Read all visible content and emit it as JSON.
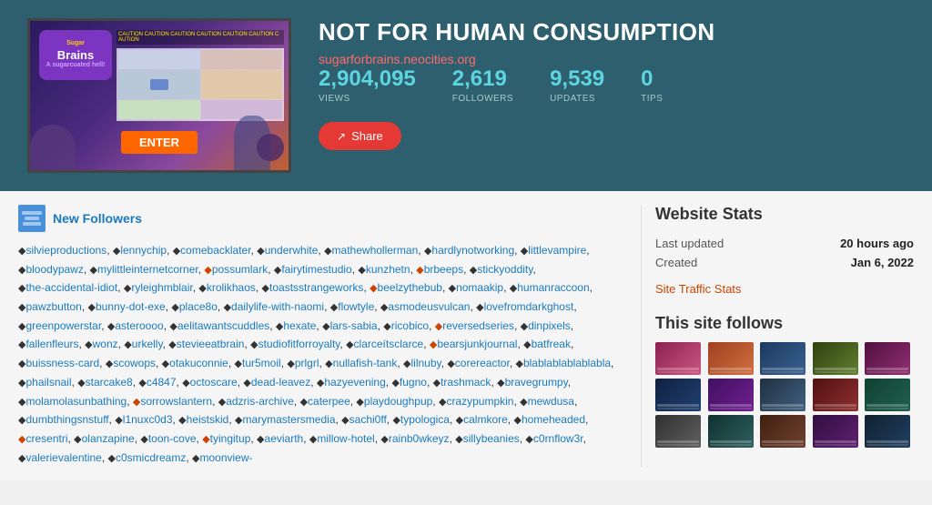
{
  "hero": {
    "title": "NOT FOR HUMAN CONSUMPTION",
    "url": "sugarforbrains.neocities.org",
    "stats": {
      "views": {
        "value": "2,904,095",
        "label": "VIEWS"
      },
      "followers": {
        "value": "2,619",
        "label": "FOLLOWERS"
      },
      "updates": {
        "value": "9,539",
        "label": "UPDATES"
      },
      "tips": {
        "value": "0",
        "label": "TIPS"
      }
    },
    "share_button": "Share"
  },
  "followers_section": {
    "title": "New Followers",
    "followers_text": "silvieproductions, lennychip, comebacklater, underwhite, mathewhollerman, hardlynotworking, littlevampire, bloodypawz, mylittleinternetcorner, possumlark, fairytimestudio, kunzhetn, brbeeps, stickyoddity, the-accidental-idiot, ryleighmblair, krolikhaos, toastsstrangeworks, beelzythebub, nomaakip, humanraccoon, pawzbutton, bunny-dot-exe, place8o, dailylife-with-naomi, flowtyle, asmodeusvulcan, lovefromdarkghost, greenpowerstar, asteroooo, aelitawantscuddles, hexate, lars-sabia, ricobico, reversedseries, dinpixels, fallenfleurs, wonz, urkelly, stevieeatbrain, studiofitforroyalty, clarceits­ clarce, bearsjunkjournal, batfreak, buissness-card, scowops, otakuconnie, tur5moil, prlgrl, nullafish-tank, lilnuby, corereactor, blablablablablabla, phailsnail, starcake8, c4847, octoscare, dead-leavez, hazyevening, fugno, trashmack, bravegrumpy, molamolasunbathing, sorrowslantern, adzris-archive, caterpee, playdoughpup, crazypumpkin, mewdusa, dumbthingsnstuff, l1nuxc0d3, heistskid, marymastersme­dia, sachi0ff, typologica, calmkore, homeheaded, cresentri, olanzapine, toon-cove, tyingitup, aeviarth, millow-hotel, rainb0wkeyz, sillybeanies, c0rnflow3r, valerievalentine, c0smicdreamz, moonview-"
  },
  "website_stats": {
    "title": "Website Stats",
    "last_updated_label": "Last updated",
    "last_updated_value": "20 hours ago",
    "created_label": "Created",
    "created_value": "Jan 6, 2022",
    "traffic_link": "Site Traffic Stats"
  },
  "this_site_follows": {
    "title": "This site follows",
    "thumbnails": [
      {
        "color": "#8B2252",
        "label": "site1"
      },
      {
        "color": "#a04020",
        "label": "site2"
      },
      {
        "color": "#204060",
        "label": "site3"
      },
      {
        "color": "#405020",
        "label": "site4"
      },
      {
        "color": "#602040",
        "label": "site5"
      },
      {
        "color": "#203060",
        "label": "site6"
      },
      {
        "color": "#502060",
        "label": "site7"
      },
      {
        "color": "#304050",
        "label": "site8"
      },
      {
        "color": "#602020",
        "label": "site9"
      },
      {
        "color": "#306050",
        "label": "site10"
      },
      {
        "color": "#404040",
        "label": "site11"
      },
      {
        "color": "#205040",
        "label": "site12"
      },
      {
        "color": "#503020",
        "label": "site13"
      },
      {
        "color": "#402050",
        "label": "site14"
      },
      {
        "color": "#203050",
        "label": "site15"
      }
    ]
  }
}
